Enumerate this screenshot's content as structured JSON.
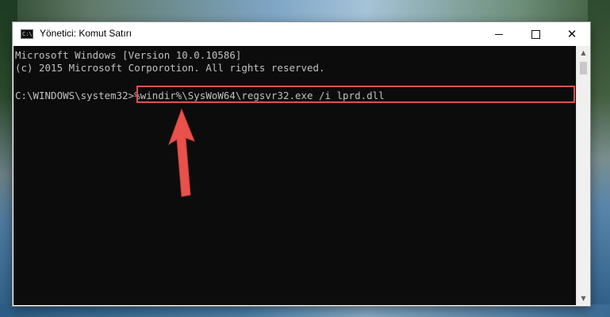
{
  "window": {
    "title": "Yönetici: Komut Satırı",
    "icon_name": "cmd-icon",
    "icon_text": "C:\\",
    "controls": {
      "minimize_icon": "minimize-icon",
      "maximize_icon": "maximize-icon",
      "close_icon": "close-icon",
      "close_glyph": "✕"
    }
  },
  "console": {
    "line1": "Microsoft Windows [Version 10.0.10586]",
    "line2": "(c) 2015 Microsoft Corporotion. All rights reserved.",
    "prompt": "C:\\WINDOWS\\system32>",
    "command": "%windir%\\SysWoW64\\regsvr32.exe /i lprd.dll",
    "text_color": "#c0c0c0",
    "background_color": "#0c0c0c"
  },
  "annotation": {
    "highlight_color": "#e05050",
    "arrow_icon": "arrow-up-icon"
  },
  "scrollbar": {
    "up_glyph": "▲",
    "down_glyph": "▼"
  }
}
